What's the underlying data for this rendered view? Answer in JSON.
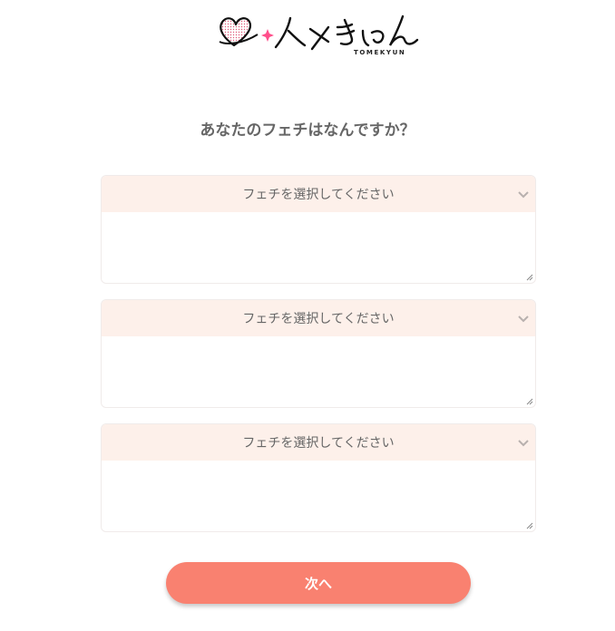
{
  "logo": {
    "wordmark": "トメきゅん",
    "subtitle": "TOMEKYUN"
  },
  "question": "あなたのフェチはなんですか？",
  "fetishes": [
    {
      "select_label": "フェチを選択してください",
      "text_value": ""
    },
    {
      "select_label": "フェチを選択してください",
      "text_value": ""
    },
    {
      "select_label": "フェチを選択してください",
      "text_value": ""
    }
  ],
  "next_button": "次へ",
  "colors": {
    "accent": "#f98170",
    "select_bg": "#fdf0ea",
    "heart_dots": "#e05a7a",
    "sparkle": "#ff4f8b"
  },
  "icons": [
    "heart-logo-icon",
    "sparkle-icon",
    "chevron-down-icon",
    "resize-handle-icon"
  ]
}
